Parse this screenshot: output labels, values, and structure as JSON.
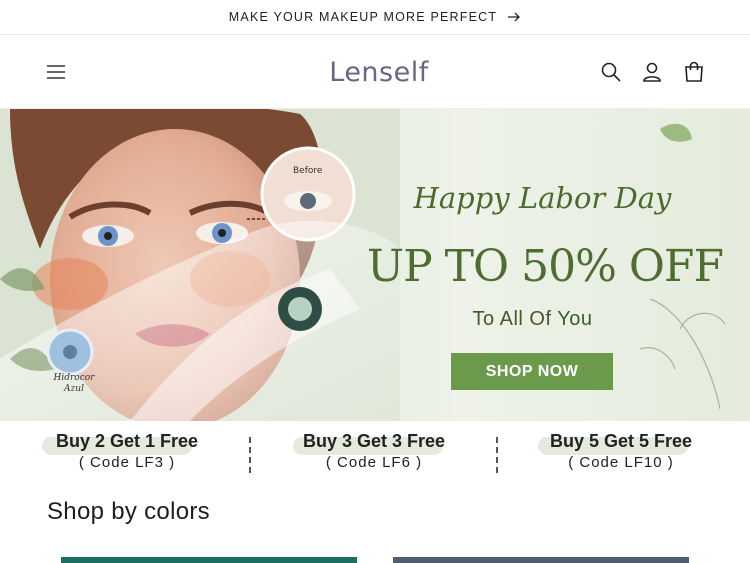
{
  "announcement": {
    "text": "MAKE YOUR MAKEUP MORE PERFECT",
    "arrow_icon": "arrow-right-icon"
  },
  "header": {
    "logo": "Lenself",
    "icons": [
      "menu-icon",
      "search-icon",
      "account-icon",
      "cart-icon"
    ]
  },
  "hero": {
    "before_label": "Before",
    "lens_label_line1": "Hidrocor",
    "lens_label_line2": "Azul",
    "greeting": "Happy Labor Day",
    "headline": "UP TO 50% OFF",
    "subline": "To All Of You",
    "button": "SHOP NOW"
  },
  "promos": [
    {
      "title": "Buy 2 Get 1 Free",
      "code": "( Code LF3 )"
    },
    {
      "title": "Buy 3 Get 3 Free",
      "code": "( Code LF6 )"
    },
    {
      "title": "Buy 5 Get 5 Free",
      "code": "( Code LF10 )"
    }
  ],
  "section": {
    "title": "Shop by colors"
  },
  "colors": {
    "brand": "#6b6489",
    "accent_green": "#6b9a4c",
    "headline_green": "#4d6e30",
    "card_teal": "#1c6f62",
    "card_slate": "#4f5d73"
  }
}
